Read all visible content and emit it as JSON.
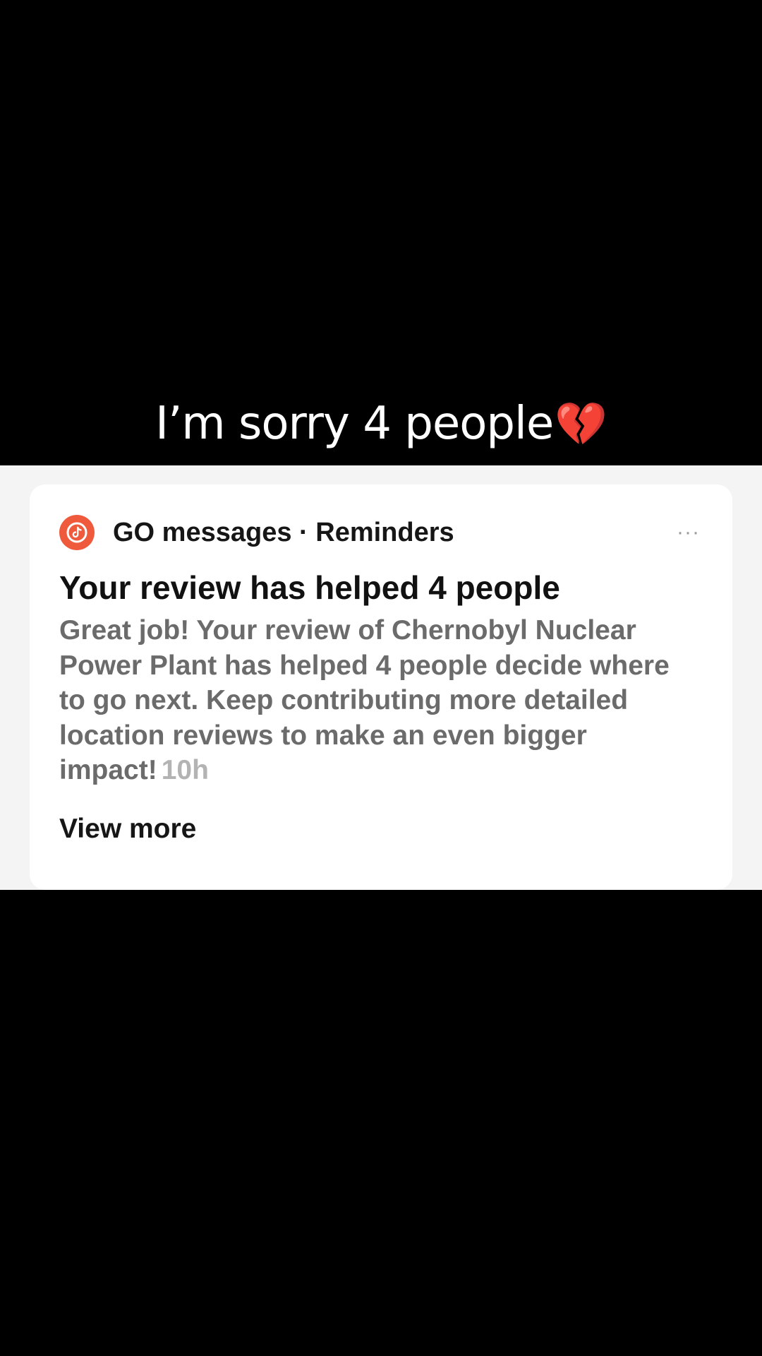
{
  "overlay": {
    "caption": "I’m sorry 4 people",
    "caption_emoji": "💔"
  },
  "notification": {
    "app_icon": "tiktok-logo-icon",
    "accent_color": "#ef5a3c",
    "sender": "GO messages · Reminders",
    "more_icon": "more-horizontal-icon",
    "more_label": "···",
    "title": "Your review has helped 4 people",
    "body": "Great job! Your review of Chernobyl Nuclear Power Plant has helped 4 people decide where to go next. Keep contributing more detailed location reviews to make an even bigger impact!",
    "timestamp": "10h",
    "view_more_label": "View more"
  }
}
